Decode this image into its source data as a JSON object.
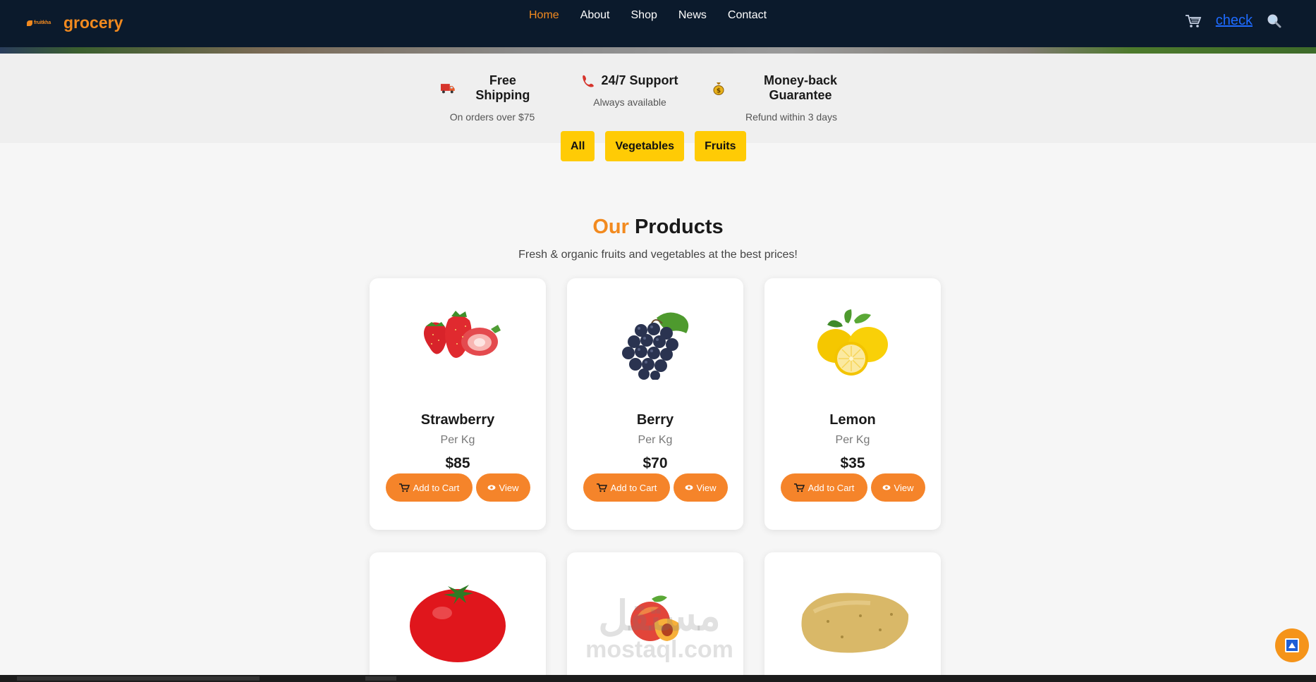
{
  "nav": {
    "brand_logo_text": "fruitkha",
    "brand_name": "grocery",
    "links": [
      "Home",
      "About",
      "Shop",
      "News",
      "Contact"
    ],
    "check_label": "check"
  },
  "features": [
    {
      "icon": "truck-icon",
      "title": "Free Shipping",
      "subtitle": "On orders over $75"
    },
    {
      "icon": "phone-icon",
      "title": "24/7 Support",
      "subtitle": "Always available"
    },
    {
      "icon": "money-bag-icon",
      "title": "Money-back Guarantee",
      "subtitle": "Refund within 3 days"
    }
  ],
  "filters": [
    "All",
    "Vegetables",
    "Fruits"
  ],
  "section": {
    "title_accent": "Our",
    "title_rest": "Products",
    "subtitle": "Fresh & organic fruits and vegetables at the best prices!"
  },
  "products": [
    {
      "name": "Strawberry",
      "unit": "Per Kg",
      "price": "$85",
      "cart_label": "Add to Cart",
      "view_label": "View"
    },
    {
      "name": "Berry",
      "unit": "Per Kg",
      "price": "$70",
      "cart_label": "Add to Cart",
      "view_label": "View"
    },
    {
      "name": "Lemon",
      "unit": "Per Kg",
      "price": "$35",
      "cart_label": "Add to Cart",
      "view_label": "View"
    },
    {
      "name": "Tomato",
      "unit": "",
      "price": "",
      "cart_label": "",
      "view_label": ""
    },
    {
      "name": "Peach",
      "unit": "",
      "price": "",
      "cart_label": "",
      "view_label": ""
    },
    {
      "name": "Potato",
      "unit": "",
      "price": "",
      "cart_label": "",
      "view_label": ""
    }
  ],
  "watermark": {
    "arabic": "مستقل",
    "latin": "mostaql.com"
  },
  "colors": {
    "navbar": "#0b1a2c",
    "accent": "#f28a1f",
    "filter_bg": "#ffcb05",
    "button": "#f5842a"
  }
}
